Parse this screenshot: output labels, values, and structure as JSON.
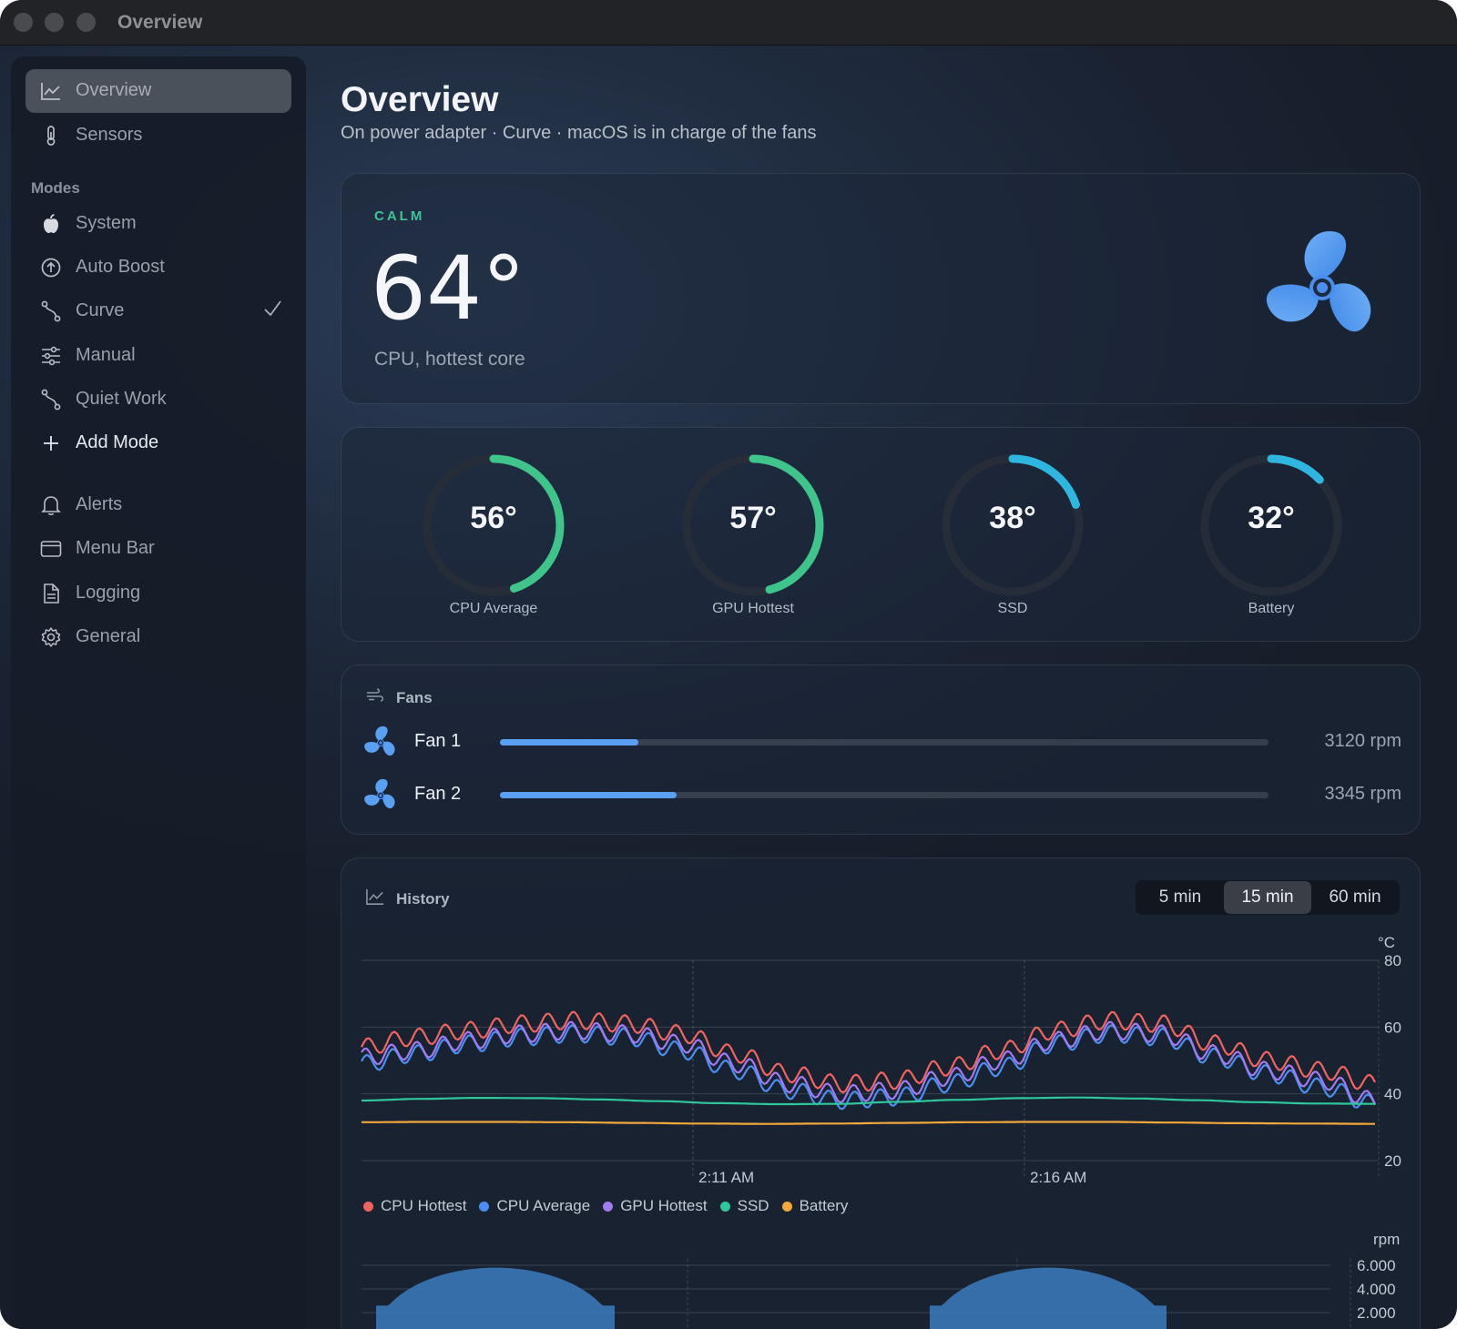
{
  "window": {
    "title": "Overview"
  },
  "sidebar": {
    "top_items": [
      {
        "label": "Overview",
        "icon": "chart-line-icon",
        "active": true
      },
      {
        "label": "Sensors",
        "icon": "thermometer-icon"
      }
    ],
    "modes_heading": "Modes",
    "modes": [
      {
        "label": "System",
        "icon": "apple-icon"
      },
      {
        "label": "Auto Boost",
        "icon": "arrow-up-circle-icon"
      },
      {
        "label": "Curve",
        "icon": "curve-icon",
        "selected": true
      },
      {
        "label": "Manual",
        "icon": "sliders-icon"
      },
      {
        "label": "Quiet Work",
        "icon": "curve-icon"
      },
      {
        "label": "Add Mode",
        "icon": "plus-icon"
      }
    ],
    "bottom_items": [
      {
        "label": "Alerts",
        "icon": "bell-icon"
      },
      {
        "label": "Menu Bar",
        "icon": "window-icon"
      },
      {
        "label": "Logging",
        "icon": "document-icon"
      },
      {
        "label": "General",
        "icon": "gear-icon"
      }
    ]
  },
  "header": {
    "title": "Overview",
    "subtitle": "On power adapter · Curve · macOS is in charge of the fans"
  },
  "hero": {
    "status": "CALM",
    "temperature": "64°",
    "caption": "CPU, hottest core",
    "status_color": "#3fc49a",
    "icon": "fan-icon"
  },
  "gauges": [
    {
      "value": "56°",
      "label": "CPU Average",
      "fraction": 0.45,
      "color": "#3fc48c"
    },
    {
      "value": "57°",
      "label": "GPU Hottest",
      "fraction": 0.46,
      "color": "#3fc48c"
    },
    {
      "value": "38°",
      "label": "SSD",
      "fraction": 0.2,
      "color": "#2fb6e0"
    },
    {
      "value": "32°",
      "label": "Battery",
      "fraction": 0.13,
      "color": "#2fb6e0"
    }
  ],
  "fans": {
    "heading": "Fans",
    "items": [
      {
        "name": "Fan 1",
        "rpm": "3120 rpm",
        "fraction": 0.18
      },
      {
        "name": "Fan 2",
        "rpm": "3345 rpm",
        "fraction": 0.23
      }
    ]
  },
  "history": {
    "heading": "History",
    "ranges": [
      {
        "label": "5 min"
      },
      {
        "label": "15 min",
        "selected": true
      },
      {
        "label": "60 min"
      }
    ],
    "legend": [
      {
        "label": "CPU Hottest",
        "color": "#f0635f"
      },
      {
        "label": "CPU Average",
        "color": "#4a8ff0"
      },
      {
        "label": "GPU Hottest",
        "color": "#a07af0"
      },
      {
        "label": "SSD",
        "color": "#2fc79a"
      },
      {
        "label": "Battery",
        "color": "#f2a83a"
      }
    ]
  },
  "chart_data": [
    {
      "type": "line",
      "unit": "°C",
      "ylim": [
        20,
        80
      ],
      "yticks": [
        "80",
        "60",
        "40",
        "20"
      ],
      "xticks": [
        "2:11 AM",
        "2:16 AM"
      ],
      "grid": true,
      "series": [
        {
          "name": "CPU Hottest",
          "values": [
            54,
            57,
            59,
            61,
            62,
            61,
            58,
            52,
            46,
            43,
            44,
            48,
            53,
            59,
            62,
            61,
            55,
            50,
            47,
            43
          ]
        },
        {
          "name": "CPU Average",
          "values": [
            49,
            52,
            55,
            57,
            58,
            57,
            53,
            47,
            41,
            38,
            39,
            43,
            48,
            55,
            58,
            57,
            51,
            46,
            42,
            37
          ]
        },
        {
          "name": "GPU Hottest",
          "values": [
            51,
            53,
            56,
            58,
            59,
            58,
            55,
            49,
            43,
            40,
            41,
            45,
            50,
            56,
            59,
            58,
            52,
            47,
            44,
            38
          ]
        },
        {
          "name": "SSD",
          "values": [
            38,
            38.5,
            38.8,
            38.7,
            38.3,
            37.8,
            37.2,
            36.9,
            37,
            37.6,
            38.2,
            38.7,
            38.9,
            38.6,
            38.1,
            37.5,
            37.1,
            37
          ]
        },
        {
          "name": "Battery",
          "values": [
            31.5,
            31.6,
            31.6,
            31.5,
            31.3,
            31.1,
            31,
            31.1,
            31.3,
            31.5,
            31.6,
            31.6,
            31.4,
            31.2,
            31.1,
            31
          ]
        }
      ]
    },
    {
      "type": "area",
      "unit": "rpm",
      "yticks": [
        "6.000",
        "4.000",
        "2.000"
      ],
      "ylim": [
        0,
        6000
      ],
      "values": [
        0,
        4600,
        5800,
        4600,
        0,
        0,
        0,
        4600,
        5800,
        4600,
        0
      ]
    }
  ]
}
